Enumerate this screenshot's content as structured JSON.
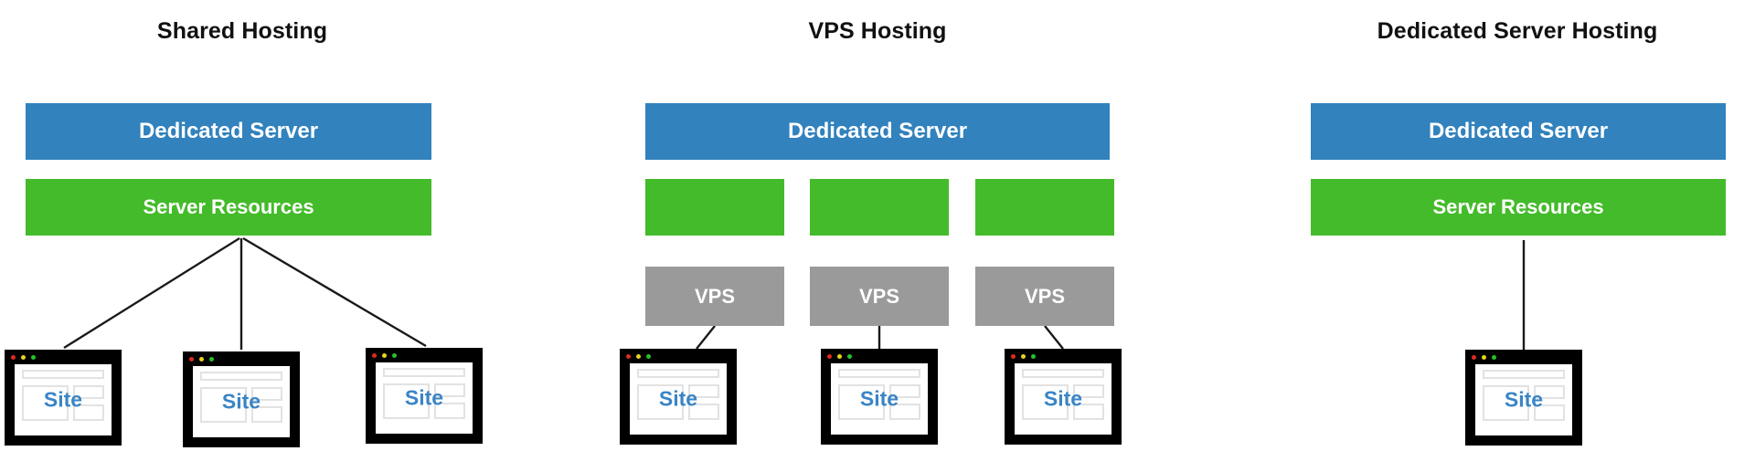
{
  "diagram": {
    "title_shared": "Shared Hosting",
    "title_vps": "VPS Hosting",
    "title_dedicated": "Dedicated Server Hosting",
    "label_dedicated_server": "Dedicated Server",
    "label_server_resources": "Server Resources",
    "label_vps": "VPS",
    "label_site": "Site",
    "colors": {
      "blue": "#3182bd",
      "green": "#44bb2a",
      "gray": "#9a9a9a",
      "site_text": "#3a85c6",
      "line": "#1a1a1a",
      "dot_red": "#e02a1e",
      "dot_yellow": "#e8d41c",
      "dot_green": "#25c22a",
      "background": "#ffffff",
      "title_text": "#111111"
    }
  },
  "panels": [
    {
      "id": "shared-hosting",
      "title": "Shared Hosting",
      "blocks": [
        {
          "label": "Dedicated Server",
          "color": "blue"
        },
        {
          "label": "Server Resources",
          "color": "green"
        }
      ],
      "sites": [
        {
          "label": "Site"
        },
        {
          "label": "Site"
        },
        {
          "label": "Site"
        }
      ]
    },
    {
      "id": "vps-hosting",
      "title": "VPS Hosting",
      "blocks": [
        {
          "label": "Dedicated Server",
          "color": "blue"
        },
        {
          "label": "",
          "color": "green"
        },
        {
          "label": "",
          "color": "green"
        },
        {
          "label": "",
          "color": "green"
        },
        {
          "label": "VPS",
          "color": "gray"
        },
        {
          "label": "VPS",
          "color": "gray"
        },
        {
          "label": "VPS",
          "color": "gray"
        }
      ],
      "sites": [
        {
          "label": "Site"
        },
        {
          "label": "Site"
        },
        {
          "label": "Site"
        }
      ]
    },
    {
      "id": "dedicated-server-hosting",
      "title": "Dedicated Server Hosting",
      "blocks": [
        {
          "label": "Dedicated Server",
          "color": "blue"
        },
        {
          "label": "Server Resources",
          "color": "green"
        }
      ],
      "sites": [
        {
          "label": "Site"
        }
      ]
    }
  ],
  "chart_data": {
    "type": "diagram",
    "title": "Web hosting types comparison",
    "nodes": [
      {
        "panel": "Shared Hosting",
        "tier": "server",
        "label": "Dedicated Server",
        "count": 1
      },
      {
        "panel": "Shared Hosting",
        "tier": "resources",
        "label": "Server Resources",
        "count": 1
      },
      {
        "panel": "Shared Hosting",
        "tier": "site",
        "label": "Site",
        "count": 3
      },
      {
        "panel": "VPS Hosting",
        "tier": "server",
        "label": "Dedicated Server",
        "count": 1
      },
      {
        "panel": "VPS Hosting",
        "tier": "resources",
        "label": "",
        "count": 3
      },
      {
        "panel": "VPS Hosting",
        "tier": "vps",
        "label": "VPS",
        "count": 3
      },
      {
        "panel": "VPS Hosting",
        "tier": "site",
        "label": "Site",
        "count": 3
      },
      {
        "panel": "Dedicated Server Hosting",
        "tier": "server",
        "label": "Dedicated Server",
        "count": 1
      },
      {
        "panel": "Dedicated Server Hosting",
        "tier": "resources",
        "label": "Server Resources",
        "count": 1
      },
      {
        "panel": "Dedicated Server Hosting",
        "tier": "site",
        "label": "Site",
        "count": 1
      }
    ]
  }
}
